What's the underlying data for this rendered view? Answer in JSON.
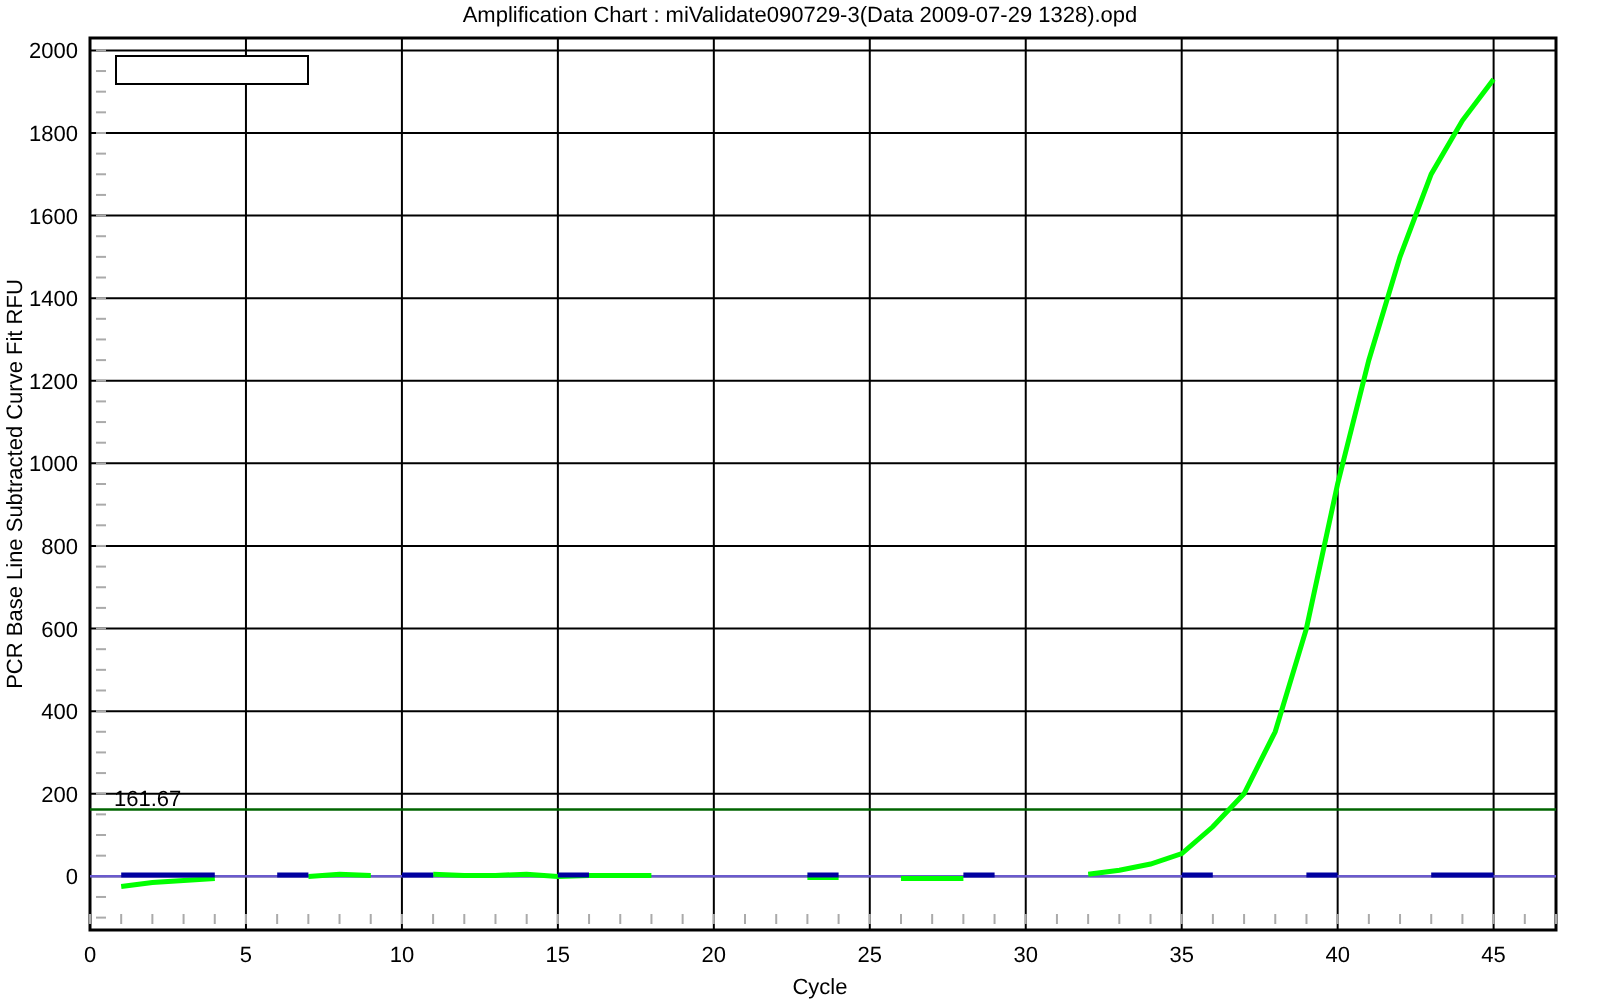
{
  "chart": {
    "chart_data": {
      "type": "line",
      "title": "Amplification Chart : miValidate090729-3(Data 2009-07-29 1328).opd",
      "xlabel": "Cycle",
      "ylabel": "PCR Base Line Subtracted Curve Fit RFU",
      "x": [
        1,
        2,
        3,
        4,
        5,
        6,
        7,
        8,
        9,
        10,
        11,
        12,
        13,
        14,
        15,
        16,
        17,
        18,
        19,
        20,
        21,
        22,
        23,
        24,
        25,
        26,
        27,
        28,
        29,
        30,
        31,
        32,
        33,
        34,
        35,
        36,
        37,
        38,
        39,
        40,
        41,
        42,
        43,
        44,
        45
      ],
      "series": [
        {
          "color": "#00ff00",
          "values": [
            -25,
            -15,
            -10,
            -5,
            null,
            null,
            0,
            5,
            2,
            null,
            5,
            2,
            2,
            5,
            0,
            2,
            2,
            2,
            null,
            null,
            null,
            null,
            -3,
            -3,
            null,
            -5,
            -5,
            -5,
            null,
            null,
            null,
            5,
            15,
            30,
            55,
            120,
            200,
            350,
            600,
            950,
            1250,
            1500,
            1700,
            1830,
            1930
          ]
        },
        {
          "color": "#0000a0",
          "values": [
            3,
            3,
            3,
            3,
            null,
            3,
            3,
            null,
            null,
            3,
            3,
            null,
            null,
            null,
            3,
            3,
            null,
            null,
            null,
            null,
            null,
            null,
            3,
            3,
            null,
            null,
            null,
            3,
            3,
            null,
            null,
            null,
            null,
            null,
            3,
            3,
            null,
            null,
            3,
            3,
            null,
            null,
            3,
            3,
            3
          ]
        }
      ],
      "xlim": [
        0,
        47
      ],
      "ylim": [
        -130,
        2030
      ],
      "xticks": [
        0,
        5,
        10,
        15,
        20,
        25,
        30,
        35,
        40,
        45
      ],
      "yticks": [
        0,
        200,
        400,
        600,
        800,
        1000,
        1200,
        1400,
        1600,
        1800,
        2000
      ],
      "grid": true,
      "ref_lines": [
        {
          "axis": "y",
          "value": 161.67,
          "label": "161.67",
          "color": "#006400"
        },
        {
          "axis": "y",
          "value": 0,
          "color": "#6a5acd"
        }
      ]
    }
  }
}
